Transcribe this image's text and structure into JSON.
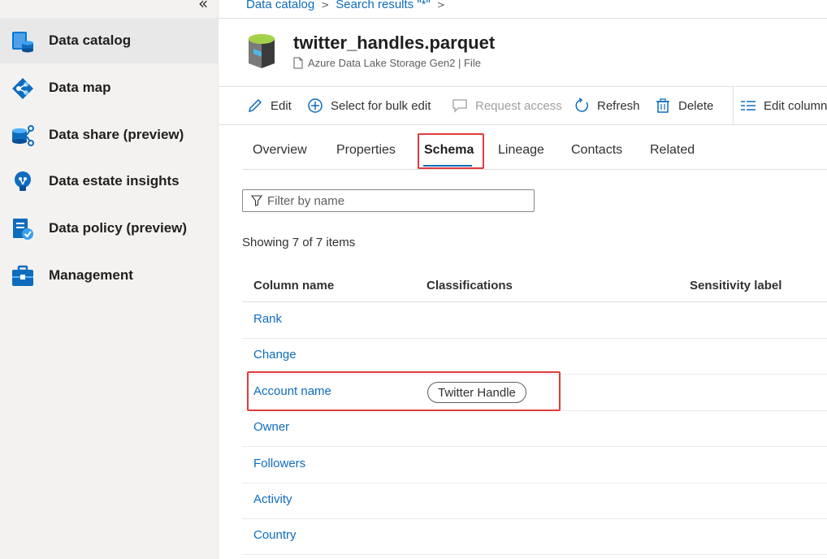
{
  "sidebar": {
    "collapse_glyph": "«",
    "items": [
      {
        "label": "Data catalog",
        "icon": "data-catalog-icon",
        "selected": true
      },
      {
        "label": "Data map",
        "icon": "data-map-icon"
      },
      {
        "label": "Data share (preview)",
        "icon": "data-share-icon"
      },
      {
        "label": "Data estate insights",
        "icon": "insights-icon"
      },
      {
        "label": "Data policy (preview)",
        "icon": "data-policy-icon"
      },
      {
        "label": "Management",
        "icon": "management-icon"
      }
    ]
  },
  "breadcrumb": {
    "items": [
      "Data catalog",
      "Search results \"*\""
    ],
    "separator": ">"
  },
  "asset": {
    "title": "twitter_handles.parquet",
    "subtitle": "Azure Data Lake Storage Gen2 | File"
  },
  "toolbar": {
    "edit": "Edit",
    "bulk_edit": "Select for bulk edit",
    "request_access": "Request access",
    "refresh": "Refresh",
    "delete": "Delete",
    "edit_columns": "Edit column"
  },
  "tabs": [
    {
      "label": "Overview"
    },
    {
      "label": "Properties"
    },
    {
      "label": "Schema",
      "active": true
    },
    {
      "label": "Lineage"
    },
    {
      "label": "Contacts"
    },
    {
      "label": "Related"
    }
  ],
  "filter": {
    "placeholder": "Filter by name"
  },
  "showing": "Showing 7 of 7 items",
  "table": {
    "headers": [
      "Column name",
      "Classifications",
      "Sensitivity label"
    ],
    "rows": [
      {
        "name": "Rank",
        "classification": ""
      },
      {
        "name": "Change",
        "classification": ""
      },
      {
        "name": "Account name",
        "classification": "Twitter Handle"
      },
      {
        "name": "Owner",
        "classification": ""
      },
      {
        "name": "Followers",
        "classification": ""
      },
      {
        "name": "Activity",
        "classification": ""
      },
      {
        "name": "Country",
        "classification": ""
      }
    ]
  },
  "colors": {
    "accent": "#0f6cbd",
    "highlight": "#e03c3c"
  }
}
